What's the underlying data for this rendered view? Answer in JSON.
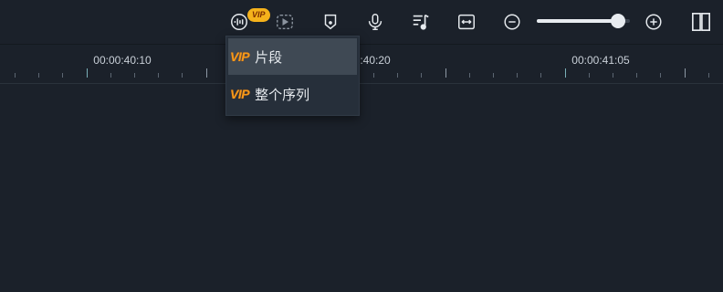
{
  "toolbar": {
    "vip_badge": "VIP",
    "icons": [
      "audio-wave-icon",
      "play-clip-icon",
      "marker-icon",
      "microphone-icon",
      "music-list-icon",
      "fit-width-icon",
      "zoom-out-icon",
      "zoom-in-icon",
      "split-view-icon"
    ],
    "zoom_level": 0.87
  },
  "ruler": {
    "labels": [
      "00:00:40:10",
      "00:00:40:20",
      "00:00:41:05"
    ]
  },
  "dropdown": {
    "items": [
      {
        "badge": "VIP",
        "label": "片段"
      },
      {
        "badge": "VIP",
        "label": "整个序列"
      }
    ]
  },
  "colors": {
    "background": "#1b212a",
    "vip_badge": "#f5b21b",
    "vip_text": "#f59a1a",
    "menu_bg": "#262f3a",
    "menu_hover": "#3f4954"
  }
}
